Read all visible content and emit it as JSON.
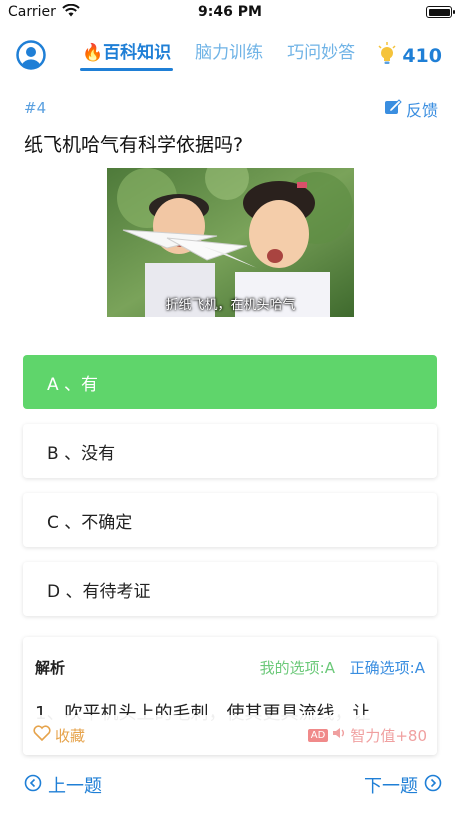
{
  "status_bar": {
    "carrier": "Carrier",
    "time": "9:46 PM"
  },
  "nav": {
    "tabs": [
      {
        "label": "🔥百科知识",
        "active": true
      },
      {
        "label": "脑力训练",
        "active": false
      },
      {
        "label": "巧问妙答",
        "active": false
      }
    ],
    "score": "410"
  },
  "question": {
    "number": "#4",
    "feedback_label": "反馈",
    "text": "纸飞机哈气有科学依据吗?",
    "image_caption": "折纸飞机，在机头哈气"
  },
  "options": [
    {
      "label": "A 、有",
      "selected": true
    },
    {
      "label": "B 、没有",
      "selected": false
    },
    {
      "label": "C 、不确定",
      "selected": false
    },
    {
      "label": "D 、有待考证",
      "selected": false
    }
  ],
  "analysis": {
    "title": "解析",
    "my_choice": "我的选项:A",
    "correct_choice": "正确选项:A",
    "text": "1、吹平机头上的毛刺，使其更具流线，让",
    "favorite_label": "收藏",
    "ad_tag": "AD",
    "reward_label": "智力值+80"
  },
  "footer": {
    "prev_label": "上一题",
    "next_label": "下一题"
  },
  "colors": {
    "accent": "#1f7fd6",
    "selected": "#5fd56b"
  }
}
